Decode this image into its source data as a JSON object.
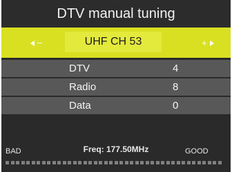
{
  "title": "DTV manual tuning",
  "channel": {
    "value": "UHF CH 53",
    "left_arrow": "left-arrow-icon",
    "right_arrow": "right-arrow-icon"
  },
  "results": [
    {
      "label": "DTV",
      "value": "4"
    },
    {
      "label": "Radio",
      "value": "8"
    },
    {
      "label": "Data",
      "value": "0"
    }
  ],
  "signal": {
    "bad_label": "BAD",
    "good_label": "GOOD",
    "frequency": "Freq: 177.50MHz",
    "quality_fraction": 0
  },
  "colors": {
    "highlight": "#d9e021",
    "background": "#2a2a2a",
    "row": "#585858"
  }
}
